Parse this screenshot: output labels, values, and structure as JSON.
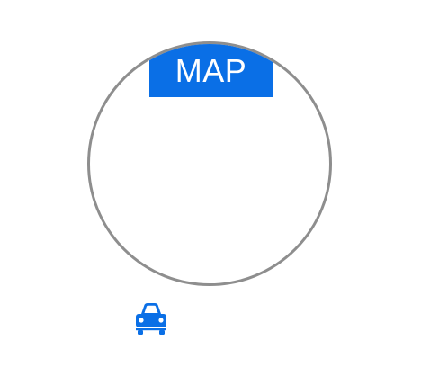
{
  "map_widget": {
    "tab_label": "MAP"
  },
  "icons": {
    "car": "car-icon"
  },
  "colors": {
    "accent": "#0a6fe6",
    "circle_border": "#8e8e8e",
    "background": "#ffffff"
  }
}
